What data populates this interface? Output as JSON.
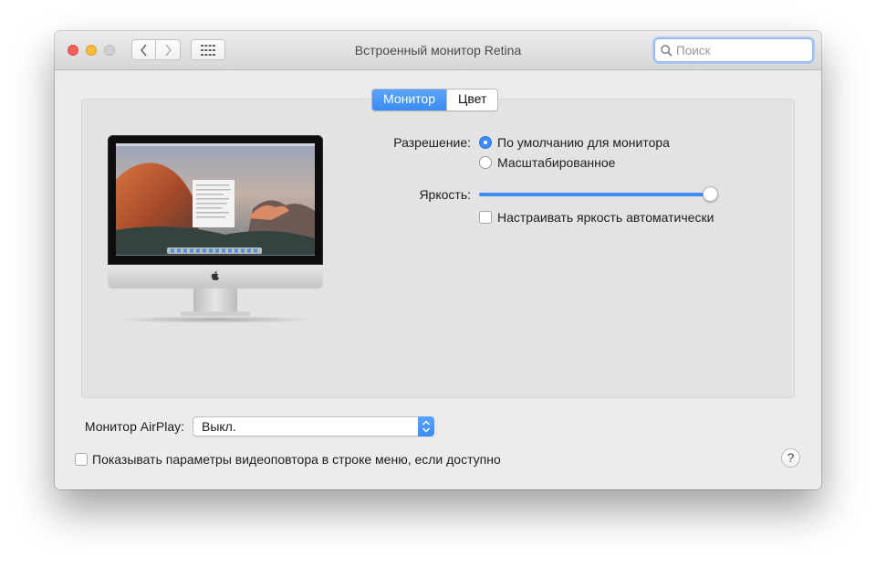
{
  "window": {
    "title": "Встроенный монитор Retina"
  },
  "search": {
    "placeholder": "Поиск"
  },
  "tabs": [
    {
      "label": "Монитор",
      "active": true
    },
    {
      "label": "Цвет",
      "active": false
    }
  ],
  "resolution": {
    "label": "Разрешение:",
    "options": [
      {
        "label": "По умолчанию для монитора",
        "selected": true
      },
      {
        "label": "Масштабированное",
        "selected": false
      }
    ]
  },
  "brightness": {
    "label": "Яркость:",
    "value_fraction": 0.96,
    "auto_label": "Настраивать яркость автоматически",
    "auto_checked": false
  },
  "airplay": {
    "label": "Монитор AirPlay:",
    "selected": "Выкл."
  },
  "mirroring": {
    "label": "Показывать параметры видеоповтора в строке меню, если доступно",
    "checked": false
  },
  "help": {
    "glyph": "?"
  },
  "colors": {
    "accent": "#3b8cf5",
    "close": "#fc605c",
    "minimize": "#fdbc40",
    "zoom": "#cfcfcf"
  }
}
